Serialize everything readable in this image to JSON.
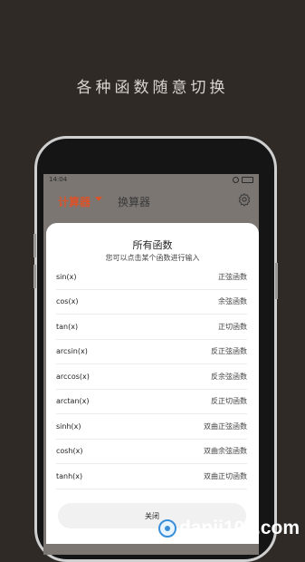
{
  "tagline": "各种函数随意切换",
  "status": {
    "time": "14:04",
    "signal": "···"
  },
  "appbar": {
    "tab_active": "计算器",
    "tab_other": "换算器",
    "settings_icon": "gear-icon"
  },
  "dialog": {
    "title": "所有函数",
    "subtitle": "您可以点击某个函数进行输入",
    "functions": [
      {
        "name": "sin(x)",
        "desc": "正弦函数"
      },
      {
        "name": "cos(x)",
        "desc": "余弦函数"
      },
      {
        "name": "tan(x)",
        "desc": "正切函数"
      },
      {
        "name": "arcsin(x)",
        "desc": "反正弦函数"
      },
      {
        "name": "arccos(x)",
        "desc": "反余弦函数"
      },
      {
        "name": "arctan(x)",
        "desc": "反正切函数"
      },
      {
        "name": "sinh(x)",
        "desc": "双曲正弦函数"
      },
      {
        "name": "cosh(x)",
        "desc": "双曲余弦函数"
      },
      {
        "name": "tanh(x)",
        "desc": "双曲正切函数"
      }
    ],
    "close_label": "关闭"
  },
  "watermark": {
    "text": "danji100.com"
  },
  "colors": {
    "accent": "#d9532b",
    "background": "#2f2a26"
  }
}
